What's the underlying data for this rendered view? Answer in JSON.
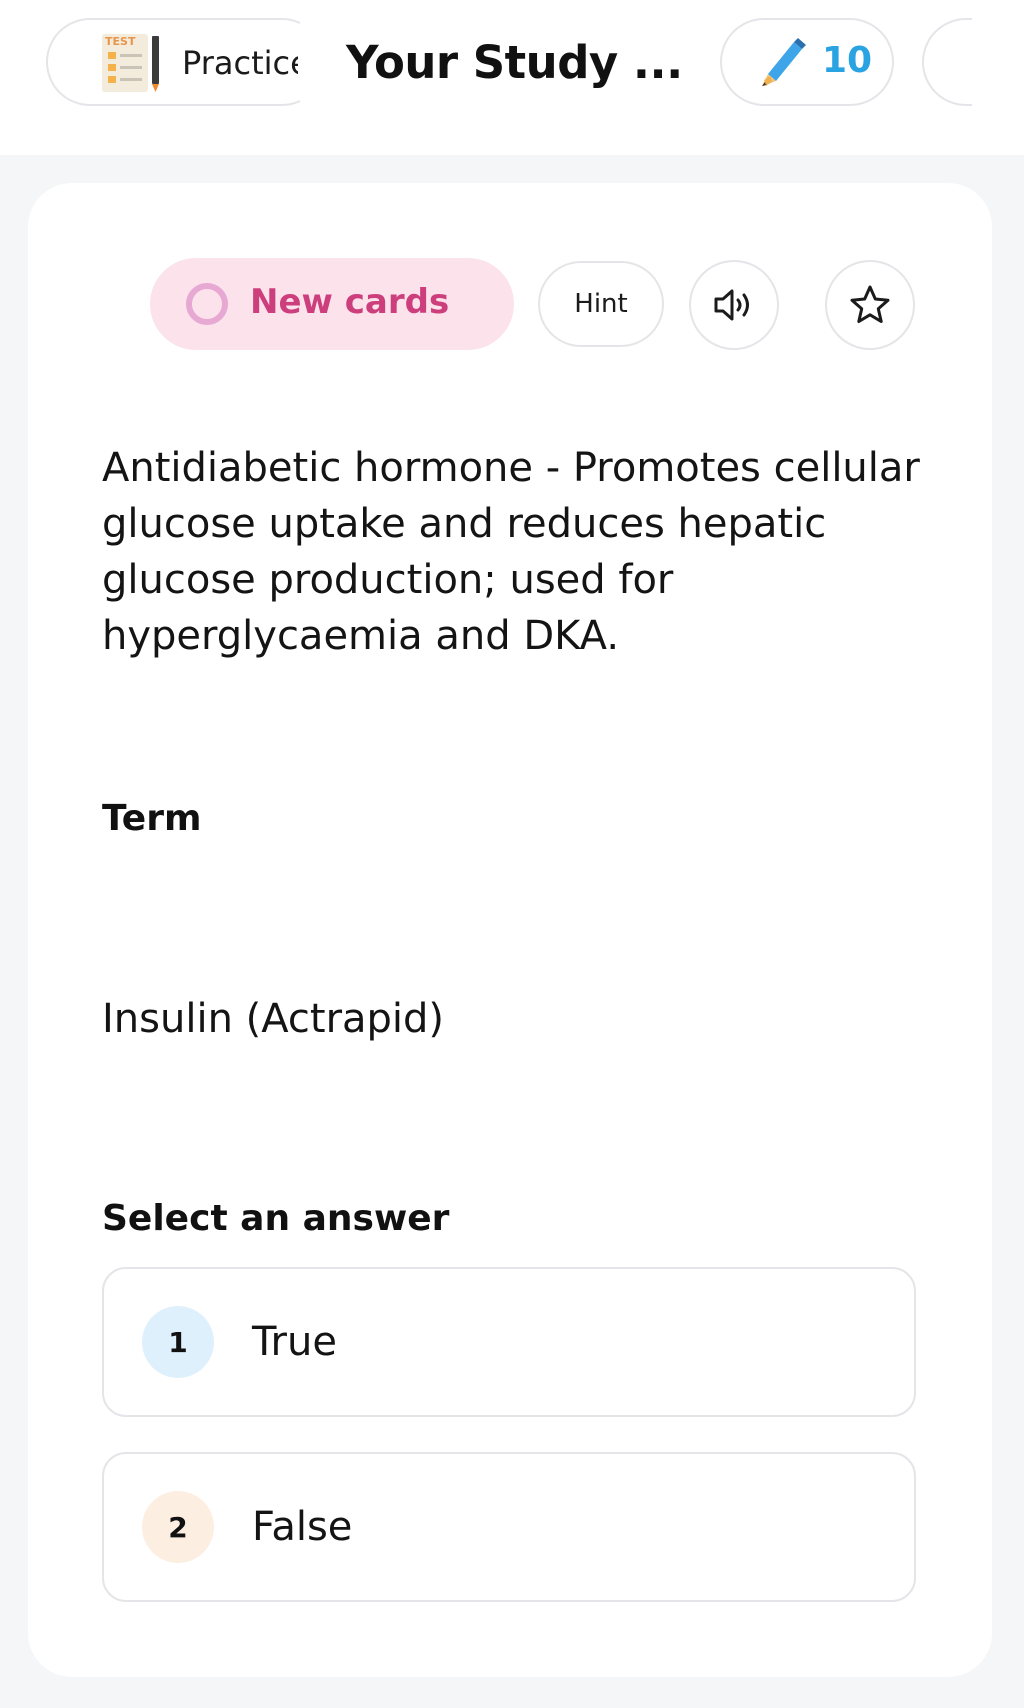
{
  "header": {
    "practice_label": "Practice",
    "title": "Your Study ...",
    "points": "10",
    "icons": {
      "practice": "test-checklist-icon",
      "points": "pencil-icon"
    }
  },
  "card": {
    "status_label": "New cards",
    "hint_label": "Hint",
    "definition": "Antidiabetic hormone - Promotes cellular glucose uptake and reduces hepatic glucose production; used for hyperglycaemia and DKA.",
    "term_heading": "Term",
    "term_value": "Insulin (Actrapid)",
    "select_heading": "Select an answer",
    "options": [
      {
        "number": "1",
        "label": "True"
      },
      {
        "number": "2",
        "label": "False"
      }
    ],
    "icons": {
      "status": "ring-icon",
      "audio": "speaker-icon",
      "favorite": "star-icon"
    }
  },
  "colors": {
    "accent_pink": "#cd3f7c",
    "status_pill_bg": "#fbe2eb",
    "points_blue": "#2aa3e3",
    "option1_badge": "#dff0fd",
    "option2_badge": "#fdeee2"
  }
}
